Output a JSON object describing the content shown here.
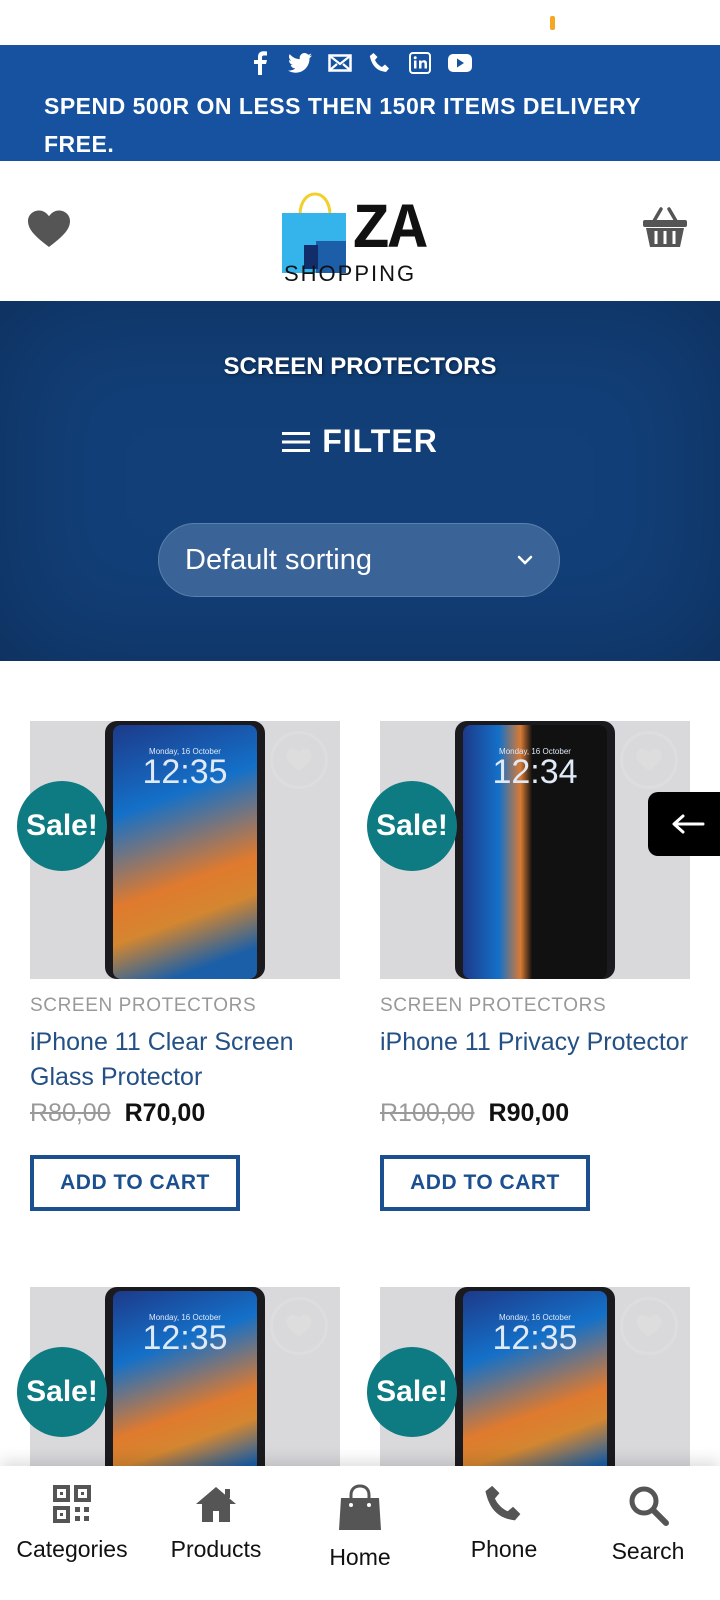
{
  "topbar": {
    "social_icons": [
      "facebook-icon",
      "twitter-icon",
      "mail-icon",
      "phone-icon",
      "linkedin-icon",
      "youtube-icon"
    ],
    "promo": "SPEND 500R ON LESS THEN 150R ITEMS DELIVERY FREE."
  },
  "header": {
    "logo_big": "ZA",
    "logo_small": "SHOPPING"
  },
  "hero": {
    "title": "SCREEN PROTECTORS",
    "filter_label": "FILTER",
    "sort_value": "Default sorting"
  },
  "products": [
    {
      "category": "SCREEN PROTECTORS",
      "name": "iPhone 11 Clear Screen Glass Protector",
      "old_price": "R80,00",
      "new_price": "R70,00",
      "badge": "Sale!",
      "button": "ADD TO CART",
      "time": "12:35",
      "date": "Monday, 16 October"
    },
    {
      "category": "SCREEN PROTECTORS",
      "name": "iPhone 11 Privacy Protector",
      "old_price": "R100,00",
      "new_price": "R90,00",
      "badge": "Sale!",
      "button": "ADD TO CART",
      "time": "12:34",
      "date": "Monday, 16 October"
    },
    {
      "badge": "Sale!",
      "time": "12:35",
      "date": "Monday, 16 October"
    },
    {
      "badge": "Sale!",
      "time": "12:35",
      "date": "Monday, 16 October"
    }
  ],
  "bottom_nav": [
    {
      "label": "Categories",
      "icon": "qr-grid-icon"
    },
    {
      "label": "Products",
      "icon": "home-icon"
    },
    {
      "label": "Home",
      "icon": "shopping-bag-icon"
    },
    {
      "label": "Phone",
      "icon": "phone-icon"
    },
    {
      "label": "Search",
      "icon": "search-icon"
    }
  ],
  "colors": {
    "brand_blue": "#1652a0",
    "hero_blue": "#123f78",
    "sale_teal": "#0e7b82",
    "link_blue": "#245085"
  }
}
